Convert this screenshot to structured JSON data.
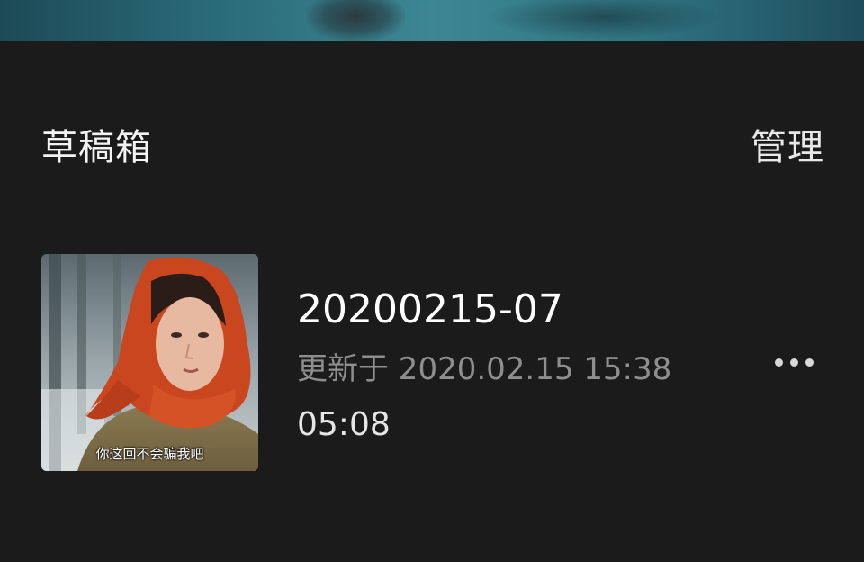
{
  "drafts_section": {
    "title": "草稿箱",
    "manage_label": "管理"
  },
  "drafts": [
    {
      "name": "20200215-07",
      "updated": "更新于 2020.02.15 15:38",
      "duration": "05:08",
      "thumbnail_caption": "你这回不会骗我吧"
    }
  ],
  "icons": {
    "more": "more-horizontal-icon"
  },
  "colors": {
    "background": "#1b1b1b",
    "primary_text": "#ffffff",
    "secondary_text": "#8e8e8e"
  }
}
